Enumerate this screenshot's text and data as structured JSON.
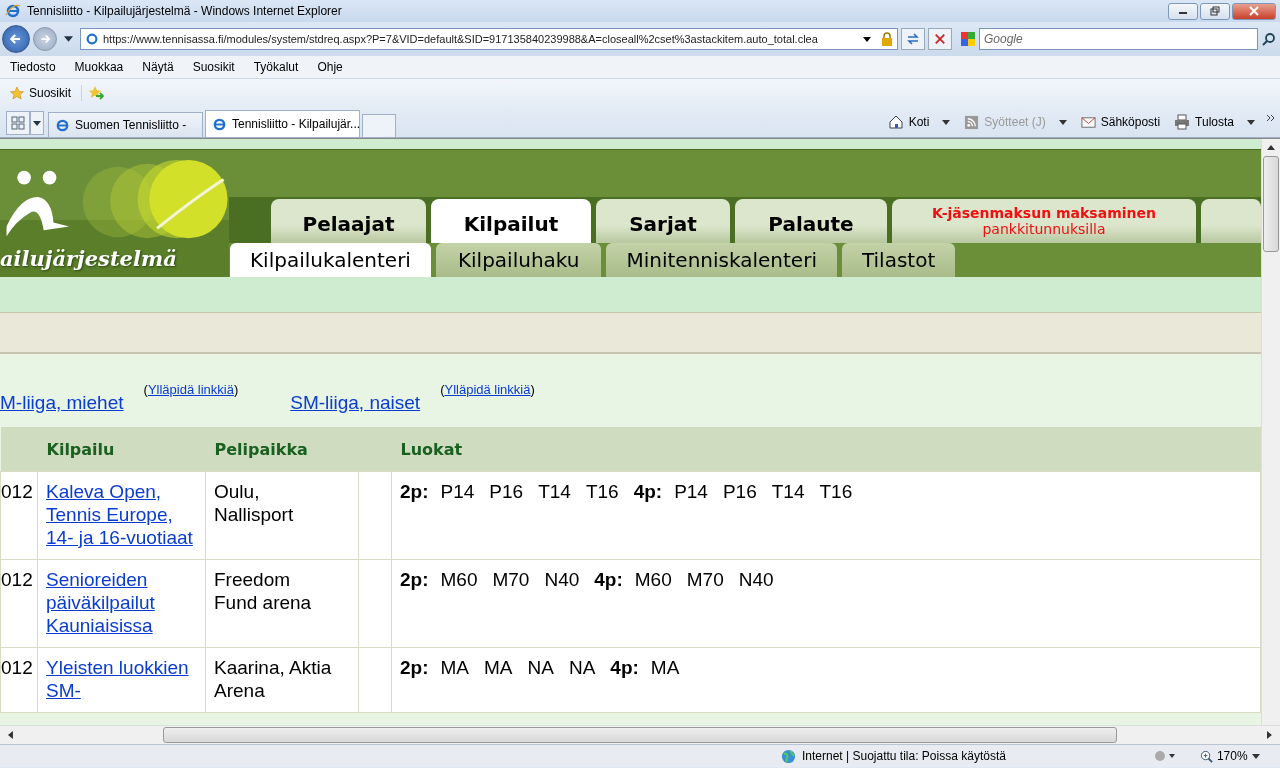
{
  "window": {
    "title": "Tennisliitto - Kilpailujärjestelmä - Windows Internet Explorer"
  },
  "address_bar": {
    "url": "https://www.tennisassa.fi/modules/system/stdreq.aspx?P=7&VID=default&SID=917135840239988&A=closeall%2cset%3astackitem.auto_total.clea",
    "search_placeholder": "Google"
  },
  "menu": [
    "Tiedosto",
    "Muokkaa",
    "Näytä",
    "Suosikit",
    "Työkalut",
    "Ohje"
  ],
  "favorites_bar": {
    "label": "Suosikit"
  },
  "browser_tabs": [
    {
      "label": "Suomen Tennisliitto -",
      "selected": false
    },
    {
      "label": "Tennisliitto - Kilpailujär...",
      "selected": true
    }
  ],
  "command_bar": [
    {
      "kind": "home",
      "label": "Koti",
      "disabled": false
    },
    {
      "kind": "feed",
      "label": "Syötteet (J)",
      "disabled": true
    },
    {
      "kind": "mail",
      "label": "Sähköposti",
      "disabled": false
    },
    {
      "kind": "print",
      "label": "Tulosta",
      "disabled": false
    }
  ],
  "logo": {
    "text": "ailujärjestelmä"
  },
  "main_tabs": [
    {
      "label": "Pelaajat",
      "selected": false
    },
    {
      "label": "Kilpailut",
      "selected": true
    },
    {
      "label": "Sarjat",
      "selected": false
    },
    {
      "label": "Palaute",
      "selected": false
    },
    {
      "label": "K-jäsenmaksun maksaminen",
      "sublabel": "pankkitunnuksilla",
      "selected": false
    }
  ],
  "sub_tabs": [
    {
      "label": "Kilpailukalenteri",
      "selected": true
    },
    {
      "label": "Kilpailuhaku",
      "selected": false
    },
    {
      "label": "Minitenniskalenteri",
      "selected": false
    },
    {
      "label": "Tilastot",
      "selected": false
    }
  ],
  "links": [
    {
      "label": "M-liiga, miehet",
      "open": "(",
      "admin": "Ylläpidä linkkiä",
      "close": ")"
    },
    {
      "label": "SM-liiga, naiset",
      "open": "(",
      "admin": "Ylläpidä linkkiä",
      "close": ")"
    }
  ],
  "table": {
    "columns": [
      "Kilpailu",
      "Pelipaikka",
      "Luokat"
    ],
    "rows": [
      {
        "date": "012",
        "name": "Kaleva Open, Tennis Europe, 14- ja 16-vuotiaat",
        "venue": "Oulu, Nallisport",
        "classes": [
          {
            "label": "2p:",
            "items": [
              "P14",
              "P16",
              "T14",
              "T16"
            ]
          },
          {
            "label": "4p:",
            "items": [
              "P14",
              "P16",
              "T14",
              "T16"
            ]
          }
        ]
      },
      {
        "date": "012",
        "name": "Senioreiden päiväkilpailut Kauniaisissa",
        "venue": "Freedom Fund arena",
        "classes": [
          {
            "label": "2p:",
            "items": [
              "M60",
              "M70",
              "N40"
            ]
          },
          {
            "label": "4p:",
            "items": [
              "M60",
              "M70",
              "N40"
            ]
          }
        ]
      },
      {
        "date": "012",
        "name": "Yleisten luokkien SM-",
        "venue": "Kaarina, Aktia Arena",
        "classes": [
          {
            "label": "2p:",
            "items": [
              "MA",
              "MA",
              "NA",
              "NA"
            ]
          },
          {
            "label": "4p:",
            "items": [
              "MA"
            ]
          }
        ]
      }
    ]
  },
  "status_bar": {
    "zone": "Internet | Suojattu tila: Poissa käytöstä",
    "zoom": "170%"
  }
}
